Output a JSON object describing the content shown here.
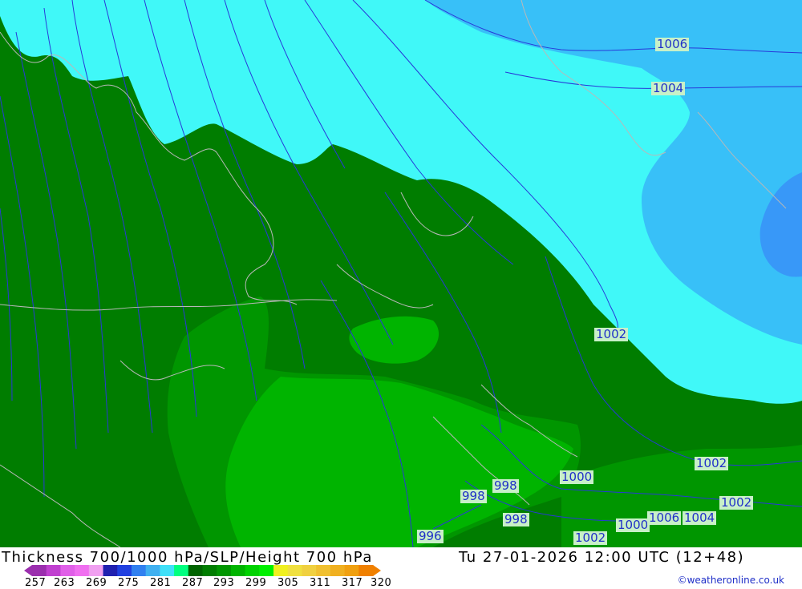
{
  "title": "Thickness 700/1000 hPa/SLP/Height 700 hPa",
  "valid_time": "Tu 27-01-2026 12:00 UTC (12+48)",
  "credit": "©weatheronline.co.uk",
  "legend": {
    "ticks": [
      "257",
      "263",
      "269",
      "275",
      "281",
      "287",
      "293",
      "299",
      "305",
      "311",
      "317",
      "320"
    ],
    "colors": [
      "#9b2fae",
      "#c040d0",
      "#e060e8",
      "#f070f0",
      "#f0a0f0",
      "#2020b0",
      "#2040e0",
      "#3080f0",
      "#40b0f0",
      "#40e0f8",
      "#00ff80",
      "#006400",
      "#007d00",
      "#009600",
      "#00b400",
      "#00d200",
      "#00f000",
      "#f0f020",
      "#f0e040",
      "#f0d040",
      "#f0c030",
      "#f0b020",
      "#f0a010",
      "#f08000"
    ]
  },
  "colors": {
    "light_cyan": "#40f8f8",
    "blue_band": "#38c0f8",
    "deep_blue": "#3898f8",
    "dark_green": "#007d00",
    "mid_green": "#009600",
    "light_green": "#00b400",
    "isobar": "#2838d8",
    "coastline": "#b8b8b8"
  },
  "isobar_labels": [
    "1006",
    "1004",
    "1002",
    "1002",
    "1002",
    "1000",
    "998",
    "998",
    "998",
    "996",
    "1002",
    "1000",
    "1006",
    "1004"
  ]
}
